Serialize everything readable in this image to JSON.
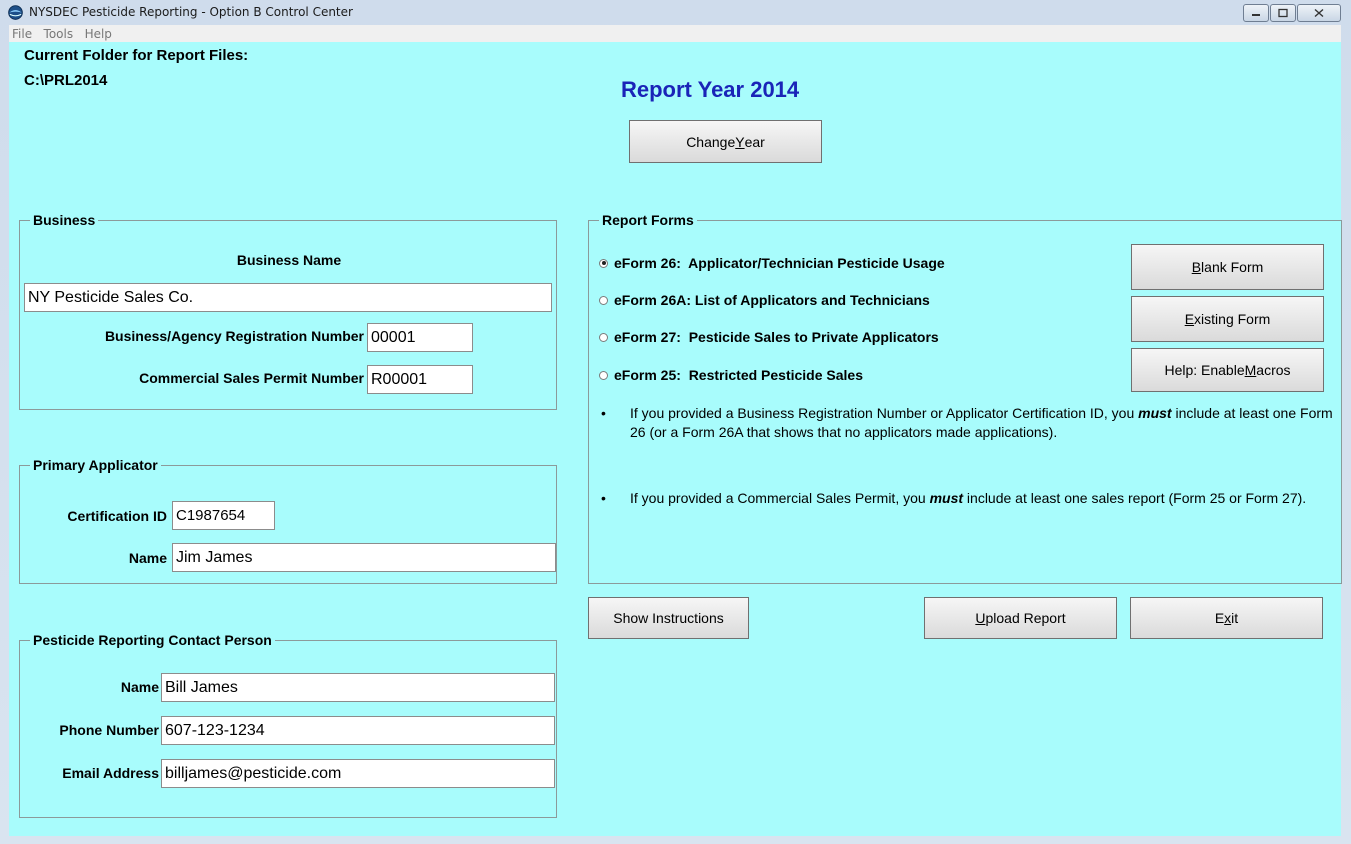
{
  "window": {
    "title": "NYSDEC Pesticide Reporting - Option B Control Center"
  },
  "menu": {
    "items": [
      "File",
      "Tools",
      "Help"
    ]
  },
  "header": {
    "folder_label": "Current Folder for Report Files:",
    "folder_path": "C:\\PRL2014",
    "report_year": "Report Year 2014",
    "change_year_pre": "Change ",
    "change_year_key": "Y",
    "change_year_post": "ear"
  },
  "business": {
    "legend": "Business",
    "name_label": "Business Name",
    "name_value": "NY Pesticide Sales Co.",
    "reg_label": "Business/Agency Registration Number",
    "reg_value": "00001",
    "permit_label": "Commercial Sales Permit Number",
    "permit_value": "R00001"
  },
  "applicator": {
    "legend": "Primary Applicator",
    "cert_label": "Certification ID",
    "cert_value": "C1987654",
    "name_label": "Name",
    "name_value": "Jim James"
  },
  "contact": {
    "legend": "Pesticide Reporting Contact Person",
    "name_label": "Name",
    "name_value": "Bill James",
    "phone_label": "Phone Number",
    "phone_value": "607-123-1234",
    "email_label": "Email Address",
    "email_value": "billjames@pesticide.com"
  },
  "report_forms": {
    "legend": "Report Forms",
    "options": [
      {
        "label": "eForm 26:  Applicator/Technician Pesticide Usage",
        "selected": true
      },
      {
        "label": "eForm 26A: List of Applicators and Technicians",
        "selected": false
      },
      {
        "label": "eForm 27:  Pesticide Sales to Private Applicators",
        "selected": false
      },
      {
        "label": "eForm 25:  Restricted Pesticide Sales",
        "selected": false
      }
    ],
    "blank_key": "B",
    "blank_rest": "lank Form",
    "existing_key": "E",
    "existing_rest": "xisting Form",
    "macros_pre": "Help: Enable ",
    "macros_key": "M",
    "macros_rest": "acros",
    "note1_pre": "If you provided a Business Registration Number or Applicator Certification ID, you ",
    "note1_em": "must",
    "note1_post": " include at least one Form 26 (or a Form 26A that shows that no applicators made applications).",
    "note2_pre": "If you provided a Commercial Sales Permit, you ",
    "note2_em": "must",
    "note2_post": " include at least one sales report (Form 25 or Form 27).",
    "bullet": "•"
  },
  "actions": {
    "show_instructions": "Show Instructions",
    "upload_key": "U",
    "upload_rest": "pload Report",
    "exit_pre": "E",
    "exit_key": "x",
    "exit_post": "it"
  },
  "colors": {
    "client_bg": "#a8fcfc",
    "year_color": "#1a24b8"
  },
  "icons": [
    "app-globe-icon",
    "minimize-icon",
    "maximize-icon",
    "close-icon",
    "radio-selected-icon",
    "radio-empty-icon"
  ]
}
